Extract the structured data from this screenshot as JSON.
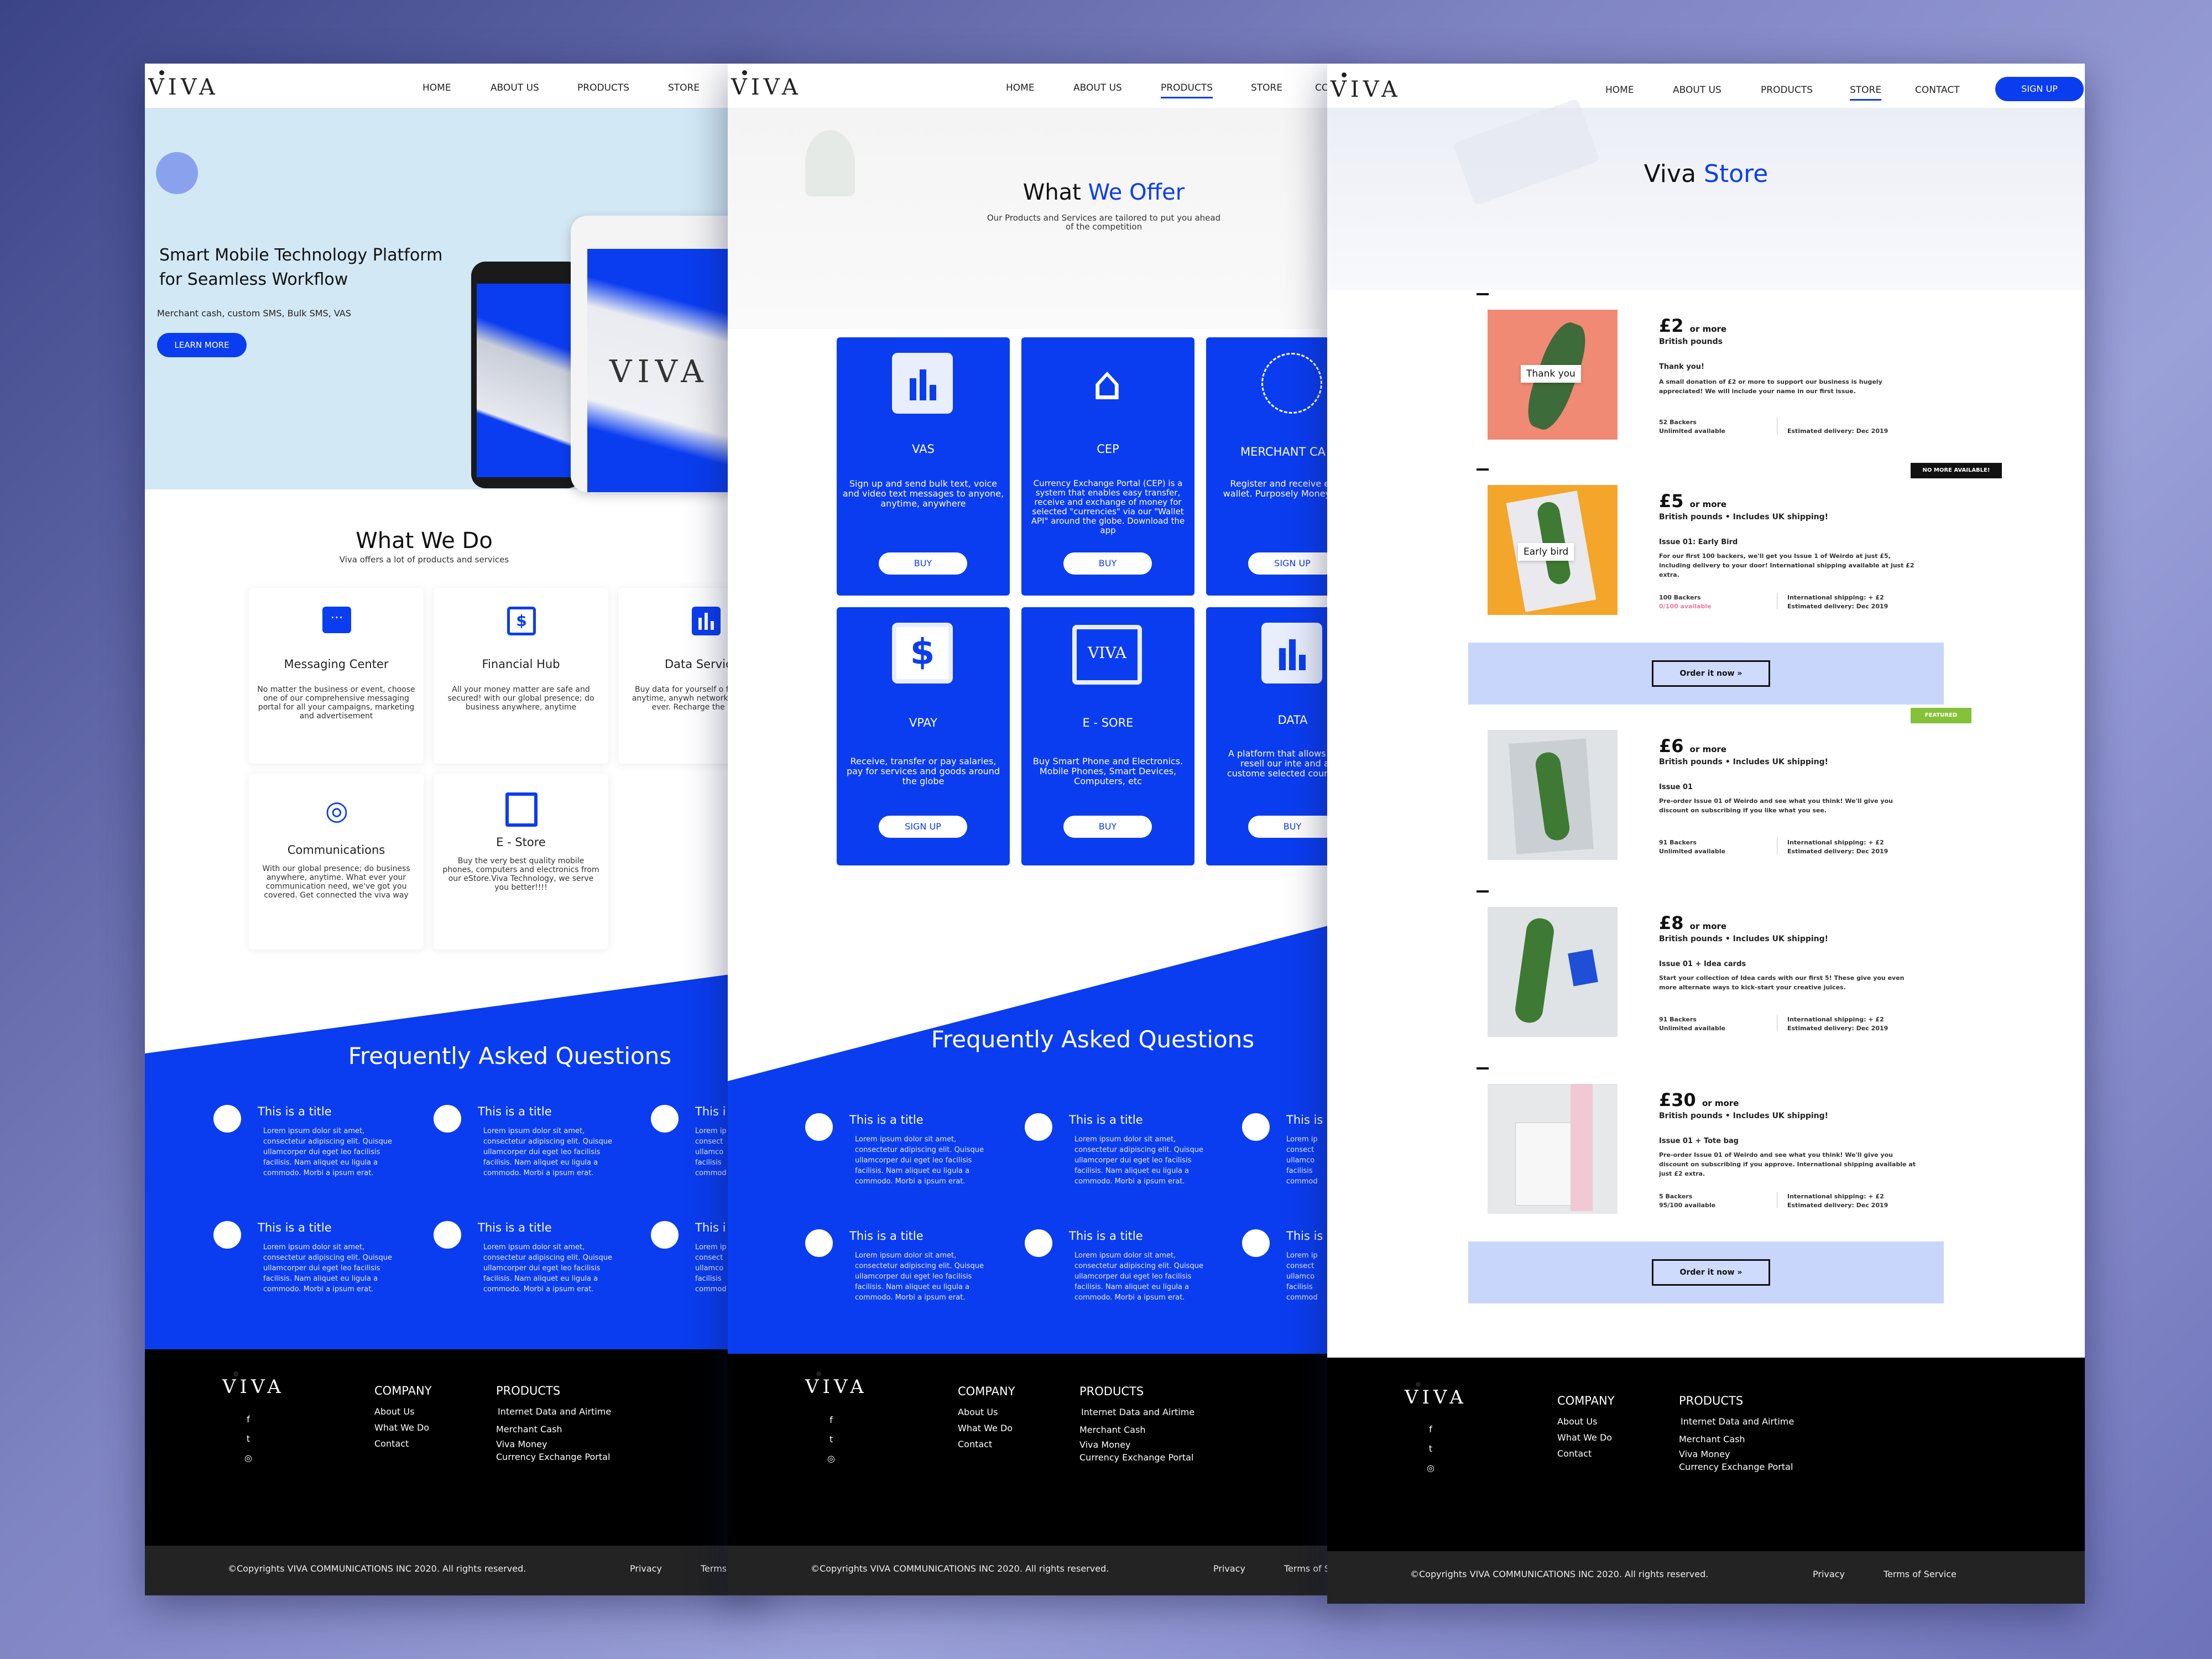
{
  "brand": {
    "logo": "VIVA"
  },
  "nav": {
    "home": "HOME",
    "about": "ABOUT US",
    "products": "PRODUCTS",
    "store": "STORE",
    "contact": "CONTACT",
    "signup": "SIGN UP",
    "contact_cut": "CC"
  },
  "home": {
    "hero_title_1": "Smart Mobile Technology Platform",
    "hero_title_2": "for Seamless Workflow",
    "hero_sub": "Merchant cash, custom SMS, Bulk  SMS, VAS",
    "hero_button": "LEARN  MORE",
    "device_logo": "VIVA",
    "what_title": "What We Do",
    "what_sub": "Viva offers a lot of products and services",
    "services": [
      {
        "title": "Messaging Center",
        "desc": "No matter the business or event, choose one of our comprehensive messaging portal for all your campaigns, marketing and advertisement",
        "icon": "chat-icon"
      },
      {
        "title": "Financial Hub",
        "desc": "All your money matter are safe and secured! with our global presence; do business anywhere, anytime",
        "icon": "dollar-icon"
      },
      {
        "title": "Data Servic",
        "desc": "Buy data for yourself o friend, anytime, anywh network, when ever. Recharge the vi",
        "icon": "bar-chart-icon"
      },
      {
        "title": "Communications",
        "desc": "With our global presence; do business anywhere, anytime. What ever your communication need, we've got you covered. Get connected the viva way",
        "icon": "broadcast-icon"
      },
      {
        "title": "E - Store",
        "desc": "Buy the very best quality mobile phones, computers and electronics from our eStore.Viva Technology, we serve you better!!!!",
        "icon": "square-icon"
      }
    ]
  },
  "faq": {
    "title": "Frequently Asked Questions",
    "item_title": "This is a title",
    "item_title_cut": "This i",
    "item_title_cut2": "This is",
    "item_body": "Lorem ipsum dolor sit amet, consectetur adipiscing elit. Quisque ullamcorper dui eget leo facilisis facilisis. Nam aliquet eu ligula a commodo. Morbi a ipsum erat.",
    "item_body_cut": "Lorem ip consect ullamco facilisis commod"
  },
  "offer": {
    "title_1": "What",
    "title_2": "We Offer",
    "sub": "Our Products and Services are tailored to put you ahead of the competition",
    "items": [
      {
        "title": "VAS",
        "desc": "Sign up and send bulk text, voice and video text messages to anyone, anytime, anywhere",
        "button": "BUY",
        "icon": "bar-chart-icon"
      },
      {
        "title": "CEP",
        "desc": "Currency Exchange Portal (CEP) is a system that enables easy transfer, receive and exchange of money for selected \"currencies\" via our \"Wallet API\" around the globe. Download the app",
        "button": "BUY",
        "icon": "bank-icon"
      },
      {
        "title": "MERCHANT CA",
        "desc": "Register and receive e-c your e-wallet. Purposely Money Vendors O",
        "button": "SIGN UP",
        "icon": "exchange-icon"
      },
      {
        "title": "VPAY",
        "desc": "Receive, transfer or pay salaries, pay for services and goods around the globe",
        "button": "SIGN UP",
        "icon": "dollar-icon"
      },
      {
        "title": "E - SORE",
        "desc": "Buy Smart Phone and Electronics. Mobile Phones, Smart Devices, Computers, etc",
        "button": "BUY",
        "icon": "monitor-icon"
      },
      {
        "title": "DATA",
        "desc": "A platform that allows retailers' to resell our inte and airtime to custome selected countries across",
        "button": "BUY",
        "icon": "bar-chart-icon"
      }
    ]
  },
  "store": {
    "title_1": "Viva",
    "title_2": "Store",
    "order_button": "Order it now »",
    "tags": {
      "sold_out": "NO MORE AVAILABLE!",
      "featured": "FEATURED"
    },
    "tiers": [
      {
        "price": "£2",
        "suffix": "or more",
        "currency": "British pounds",
        "item": "Thank you!",
        "desc": "A small donation of £2 or more to support our business is hugely appreciated! We will include your name in our first issue.",
        "backers": "52 Backers",
        "avail": "Unlimited available",
        "ship": "",
        "delivery": "Estimated delivery: Dec 2019",
        "img_label": "Thank you",
        "img_bg": "#f08a74"
      },
      {
        "price": "£5",
        "suffix": "or more",
        "currency": "British pounds • Includes UK shipping!",
        "item": "Issue 01: Early Bird",
        "desc": "For our first 100 backers, we'll get you Issue 1 of Weirdo at just £5, including delivery to your door! International shipping available at just £2 extra.",
        "backers": "100 Backers",
        "avail": "0/100 available",
        "ship": "International shipping: + £2",
        "delivery": "Estimated delivery: Dec 2019",
        "img_label": "Early bird",
        "img_bg": "#f4a62a"
      },
      {
        "price": "£6",
        "suffix": "or more",
        "currency": "British pounds • Includes UK shipping!",
        "item": "Issue 01",
        "desc": "Pre-order Issue 01 of Weirdo and see what you think! We'll give you discount on subscribing if you like what you see.",
        "backers": "91 Backers",
        "avail": "Unlimited available",
        "ship": "International shipping: + £2",
        "delivery": "Estimated delivery: Dec 2019",
        "img_label": "",
        "img_bg": "#dfe3e6"
      },
      {
        "price": "£8",
        "suffix": "or more",
        "currency": "British pounds • Includes UK shipping!",
        "item": "Issue 01 + Idea cards",
        "desc": "Start your collection of Idea cards with our first 5! These give you even more alternate ways to kick-start your creative juices.",
        "backers": "91 Backers",
        "avail": "Unlimited available",
        "ship": "International shipping: + £2",
        "delivery": "Estimated delivery: Dec 2019",
        "img_label": "",
        "img_bg": "#dfe3e6"
      },
      {
        "price": "£30",
        "suffix": "or more",
        "currency": "British pounds • Includes UK shipping!",
        "item": "Issue 01 + Tote bag",
        "desc": "Pre-order Issue 01 of Weirdo and see what you think! We'll give you discount on subscribing if you approve. International shipping available at just £2 extra.",
        "backers": "5 Backers",
        "avail": "95/100 available",
        "ship": "International shipping: + £2",
        "delivery": "Estimated delivery: Dec 2019",
        "img_label": "",
        "img_bg": "#e6e8ea"
      }
    ]
  },
  "footer": {
    "company": "COMPANY",
    "company_links": [
      "About Us",
      "What We Do",
      "Contact"
    ],
    "products": "PRODUCTS",
    "product_links": [
      "Internet Data and Airtime",
      "Merchant Cash",
      "Viva Money",
      "Currency Exchange Portal"
    ],
    "copyright": "©Copyrights VIVA COMMUNICATIONS INC 2020. All rights reserved.",
    "privacy": "Privacy",
    "terms": "Terms of Service",
    "terms_cut1": "Terms",
    "terms_cut2": "Terms of S",
    "social": {
      "facebook": "f",
      "twitter": "t",
      "instagram": "◎"
    }
  },
  "colors": {
    "primary": "#0b3df0",
    "hero_bg": "#d2e8f4",
    "footer": "#000000",
    "order_band": "#c9d6fb"
  }
}
